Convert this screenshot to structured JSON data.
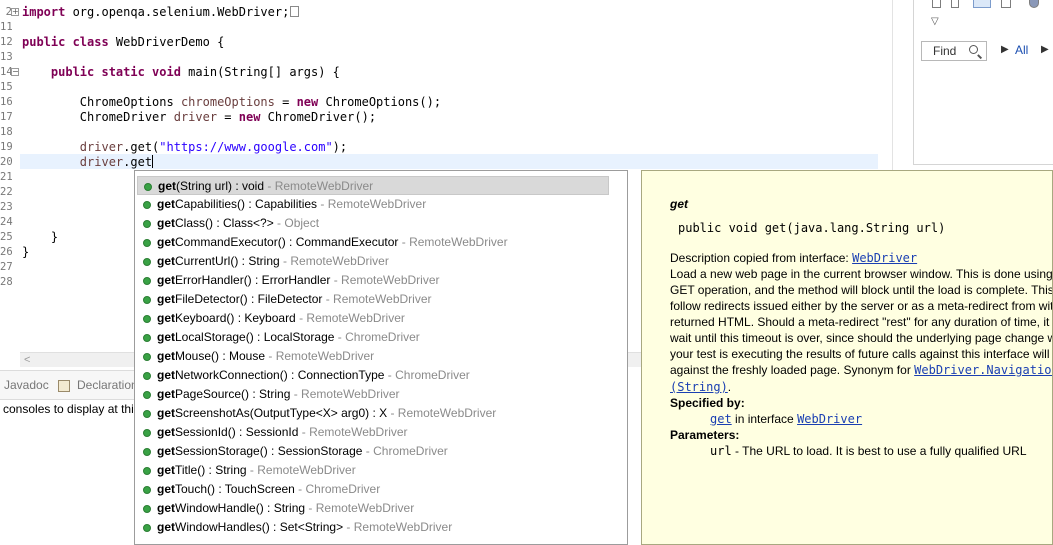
{
  "editor": {
    "lines": [
      {
        "num": "2",
        "parts": [
          {
            "t": "import",
            "c": "kw"
          },
          {
            "t": " org.openqa.selenium.WebDriver;"
          }
        ]
      },
      {
        "num": "11",
        "parts": []
      },
      {
        "num": "12",
        "parts": [
          {
            "t": "public class",
            "c": "kw"
          },
          {
            "t": " WebDriverDemo {"
          }
        ]
      },
      {
        "num": "13",
        "parts": []
      },
      {
        "num": "14",
        "parts": [
          {
            "t": "    "
          },
          {
            "t": "public static void",
            "c": "kw"
          },
          {
            "t": " main(String[] args) {"
          }
        ]
      },
      {
        "num": "15",
        "parts": []
      },
      {
        "num": "16",
        "parts": [
          {
            "t": "        ChromeOptions "
          },
          {
            "t": "chromeOptions",
            "c": "var"
          },
          {
            "t": " = "
          },
          {
            "t": "new",
            "c": "kw"
          },
          {
            "t": " ChromeOptions();"
          }
        ]
      },
      {
        "num": "17",
        "parts": [
          {
            "t": "        ChromeDriver "
          },
          {
            "t": "driver",
            "c": "var"
          },
          {
            "t": " = "
          },
          {
            "t": "new",
            "c": "kw"
          },
          {
            "t": " ChromeDriver();"
          }
        ]
      },
      {
        "num": "18",
        "parts": []
      },
      {
        "num": "19",
        "parts": [
          {
            "t": "        "
          },
          {
            "t": "driver",
            "c": "var"
          },
          {
            "t": ".get("
          },
          {
            "t": "\"https://www.google.com\"",
            "c": "str"
          },
          {
            "t": ");"
          }
        ]
      },
      {
        "num": "20",
        "parts": [
          {
            "t": "        "
          },
          {
            "t": "driver",
            "c": "var"
          },
          {
            "t": ".get"
          }
        ]
      },
      {
        "num": "21",
        "parts": []
      },
      {
        "num": "22",
        "parts": []
      },
      {
        "num": "23",
        "parts": []
      },
      {
        "num": "24",
        "parts": []
      },
      {
        "num": "25",
        "parts": [
          {
            "t": "    }"
          }
        ]
      },
      {
        "num": "26",
        "parts": [
          {
            "t": "}"
          }
        ]
      },
      {
        "num": "27",
        "parts": []
      },
      {
        "num": "28",
        "parts": []
      }
    ]
  },
  "bottom": {
    "tabs": {
      "javadoc": "Javadoc",
      "declaration": "Declaration"
    },
    "console_text": "consoles to display at thi"
  },
  "right_panel": {
    "find_placeholder": "Find",
    "all_label": "All"
  },
  "assist": {
    "proposals": [
      {
        "bold": "get",
        "rest": "(String url) : void",
        "decl": " - RemoteWebDriver",
        "selected": true
      },
      {
        "bold": "get",
        "rest": "Capabilities() : Capabilities",
        "decl": " - RemoteWebDriver"
      },
      {
        "bold": "get",
        "rest": "Class() : Class<?>",
        "decl": " - Object"
      },
      {
        "bold": "get",
        "rest": "CommandExecutor() : CommandExecutor",
        "decl": " - RemoteWebDriver"
      },
      {
        "bold": "get",
        "rest": "CurrentUrl() : String",
        "decl": " - RemoteWebDriver"
      },
      {
        "bold": "get",
        "rest": "ErrorHandler() : ErrorHandler",
        "decl": " - RemoteWebDriver"
      },
      {
        "bold": "get",
        "rest": "FileDetector() : FileDetector",
        "decl": " - RemoteWebDriver"
      },
      {
        "bold": "get",
        "rest": "Keyboard() : Keyboard",
        "decl": " - RemoteWebDriver"
      },
      {
        "bold": "get",
        "rest": "LocalStorage() : LocalStorage",
        "decl": " - ChromeDriver"
      },
      {
        "bold": "get",
        "rest": "Mouse() : Mouse",
        "decl": " - RemoteWebDriver"
      },
      {
        "bold": "get",
        "rest": "NetworkConnection() : ConnectionType",
        "decl": " - ChromeDriver"
      },
      {
        "bold": "get",
        "rest": "PageSource() : String",
        "decl": " - RemoteWebDriver"
      },
      {
        "bold": "get",
        "rest": "ScreenshotAs(OutputType<X> arg0) : X",
        "decl": " - RemoteWebDriver"
      },
      {
        "bold": "get",
        "rest": "SessionId() : SessionId",
        "decl": " - RemoteWebDriver"
      },
      {
        "bold": "get",
        "rest": "SessionStorage() : SessionStorage",
        "decl": " - ChromeDriver"
      },
      {
        "bold": "get",
        "rest": "Title() : String",
        "decl": " - RemoteWebDriver"
      },
      {
        "bold": "get",
        "rest": "Touch() : TouchScreen",
        "decl": " - ChromeDriver"
      },
      {
        "bold": "get",
        "rest": "WindowHandle() : String",
        "decl": " - RemoteWebDriver"
      },
      {
        "bold": "get",
        "rest": "WindowHandles() : Set<String>",
        "decl": " - RemoteWebDriver"
      }
    ]
  },
  "javadoc": {
    "title": "get",
    "signature": "public void get(java.lang.String url)",
    "desc_prefix": "Description copied from interface: ",
    "desc_link": "WebDriver",
    "body_lines": [
      "Load a new web page in the current browser window. This is done using",
      "GET operation, and the method will block until the load is complete. This",
      "follow redirects issued either by the server or as a meta-redirect from wit",
      "returned HTML. Should a meta-redirect \"rest\" for any duration of time, it",
      "wait until this timeout is over, since should the underlying page change w",
      "your test is executing the results of future calls against this interface will",
      "against the freshly loaded page. Synonym for "
    ],
    "synonym_link": "WebDriver.Navigation",
    "synonym_cont": "(String)",
    "synonym_end": ".",
    "specified_by_label": "Specified by:",
    "specified_by_method": "get",
    "specified_by_mid": " in interface ",
    "specified_by_iface": "WebDriver",
    "parameters_label": "Parameters:",
    "param_name": "url",
    "param_desc": " - The URL to load. It is best to use a fully qualified URL"
  }
}
